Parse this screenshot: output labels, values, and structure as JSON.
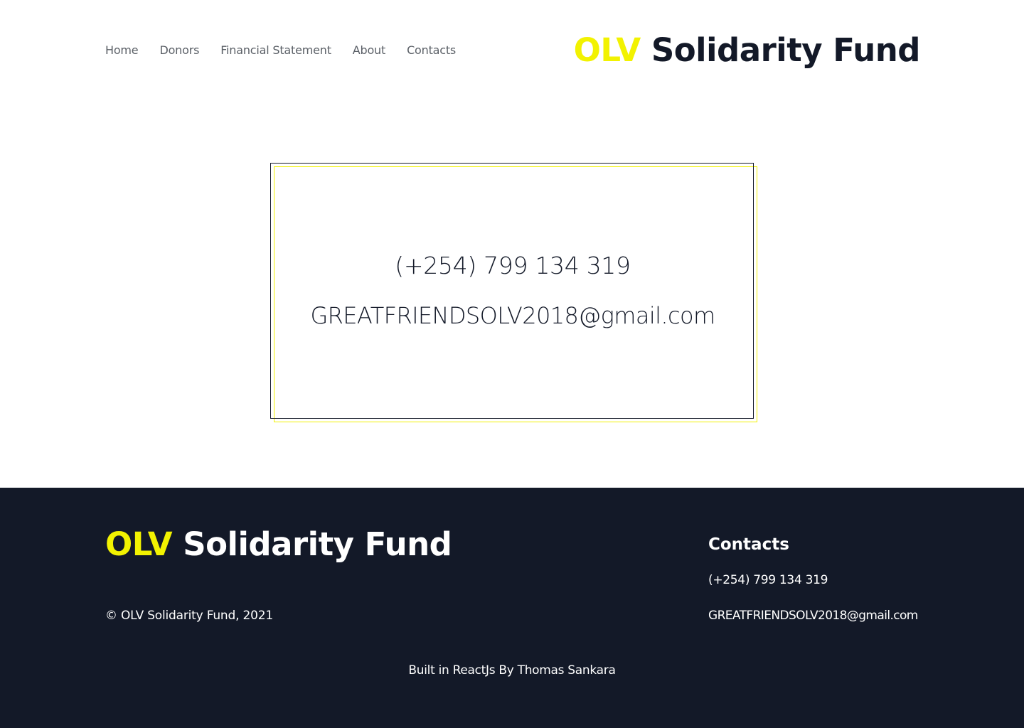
{
  "header": {
    "nav": [
      {
        "label": "Home"
      },
      {
        "label": "Donors"
      },
      {
        "label": "Financial Statement"
      },
      {
        "label": "About"
      },
      {
        "label": "Contacts"
      }
    ],
    "logo": {
      "accent": "OLV",
      "name": "Solidarity Fund"
    }
  },
  "card": {
    "phone": "(+254) 799 134 319",
    "email": "GREATFRIENDSOLV2018@gmail.com"
  },
  "footer": {
    "logo": {
      "accent": "OLV",
      "name": "Solidarity Fund"
    },
    "copyright": "© OLV Solidarity Fund, 2021",
    "contacts_title": "Contacts",
    "phone": "(+254) 799 134 319",
    "email": "GREATFRIENDSOLV2018@gmail.com",
    "built_by": "Built in ReactJs By Thomas Sankara"
  },
  "colors": {
    "accent": "#f2f201",
    "dark": "#131928",
    "nav_text": "#5a5f66"
  }
}
